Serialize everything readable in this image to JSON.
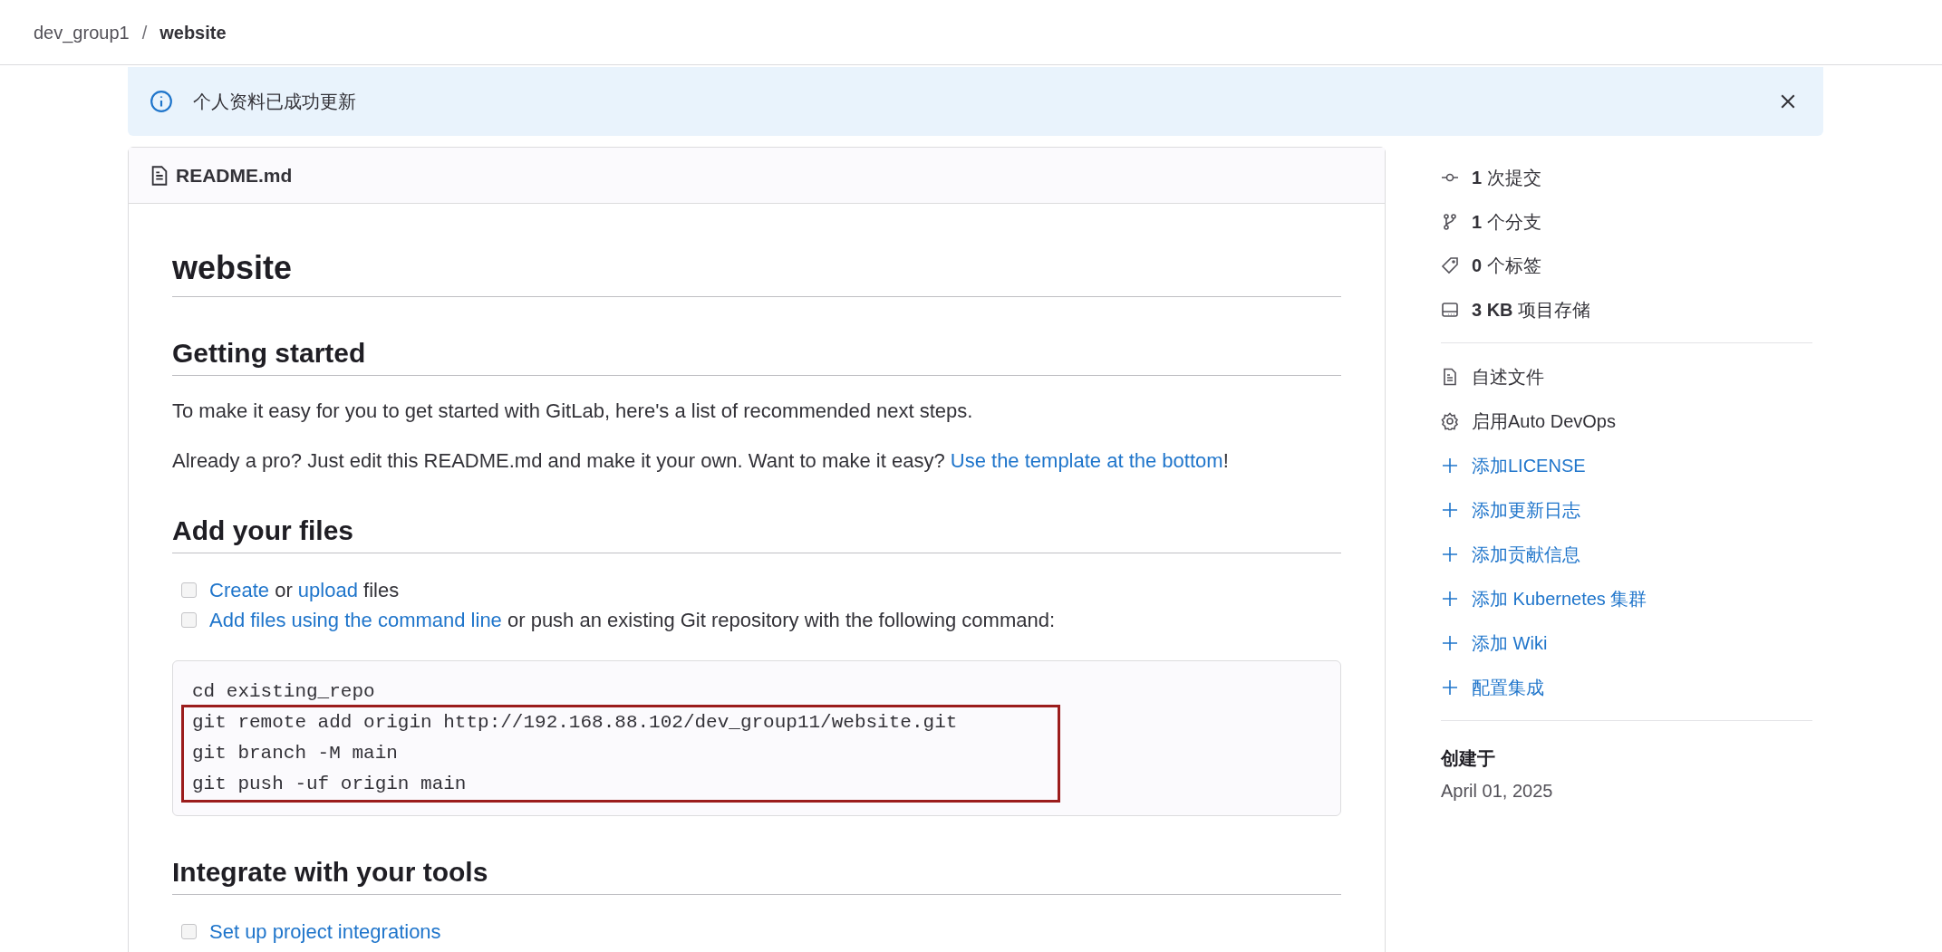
{
  "breadcrumb": {
    "separator": "/",
    "items": [
      {
        "label": "dev_group1",
        "current": false
      },
      {
        "label": "website",
        "current": true
      }
    ]
  },
  "alert": {
    "message": "个人资料已成功更新"
  },
  "readme": {
    "filename": "README.md",
    "blocks": [
      {
        "kind": "h1",
        "text": "website"
      },
      {
        "kind": "h2",
        "text": "Getting started"
      },
      {
        "kind": "p",
        "segments": [
          {
            "kind": "text",
            "text": "To make it easy for you to get started with GitLab, here's a list of recommended next steps."
          }
        ]
      },
      {
        "kind": "p",
        "segments": [
          {
            "kind": "text",
            "text": "Already a pro? Just edit this README.md and make it your own. Want to make it easy? "
          },
          {
            "kind": "link",
            "text": "Use the template at the bottom"
          },
          {
            "kind": "text",
            "text": "!"
          }
        ]
      },
      {
        "kind": "h2",
        "text": "Add your files"
      },
      {
        "kind": "tasks",
        "items": [
          {
            "checked": false,
            "segments": [
              {
                "kind": "link",
                "text": "Create"
              },
              {
                "kind": "text",
                "text": " or "
              },
              {
                "kind": "link",
                "text": "upload"
              },
              {
                "kind": "text",
                "text": " files"
              }
            ]
          },
          {
            "checked": false,
            "segments": [
              {
                "kind": "link",
                "text": "Add files using the command line"
              },
              {
                "kind": "text",
                "text": " or push an existing Git repository with the following command:"
              }
            ]
          }
        ]
      },
      {
        "kind": "code",
        "lines": [
          {
            "text": "cd existing_repo",
            "highlighted": false
          },
          {
            "text": "git remote add origin http://192.168.88.102/dev_group11/website.git",
            "highlighted": true
          },
          {
            "text": "git branch -M main",
            "highlighted": true
          },
          {
            "text": "git push -uf origin main",
            "highlighted": true
          }
        ]
      },
      {
        "kind": "h2",
        "text": "Integrate with your tools"
      },
      {
        "kind": "tasks",
        "items": [
          {
            "checked": false,
            "segments": [
              {
                "kind": "link",
                "text": "Set up project integrations"
              }
            ]
          }
        ]
      }
    ]
  },
  "sidebar": {
    "stats": [
      {
        "kind": "commit",
        "count": "1",
        "label": "次提交"
      },
      {
        "kind": "branch",
        "count": "1",
        "label": "个分支"
      },
      {
        "kind": "tag",
        "count": "0",
        "label": "个标签"
      },
      {
        "kind": "storage",
        "count": "3 KB",
        "label": "项目存储"
      }
    ],
    "actions": [
      {
        "kind": "readme",
        "label": "自述文件"
      },
      {
        "kind": "settings",
        "label": "启用Auto DevOps"
      },
      {
        "kind": "add",
        "label": "添加LICENSE"
      },
      {
        "kind": "add",
        "label": "添加更新日志"
      },
      {
        "kind": "add",
        "label": "添加贡献信息"
      },
      {
        "kind": "add",
        "label": "添加 Kubernetes 集群"
      },
      {
        "kind": "add",
        "label": "添加 Wiki"
      },
      {
        "kind": "add",
        "label": "配置集成"
      }
    ],
    "created": {
      "label": "创建于",
      "date": "April 01, 2025"
    }
  }
}
